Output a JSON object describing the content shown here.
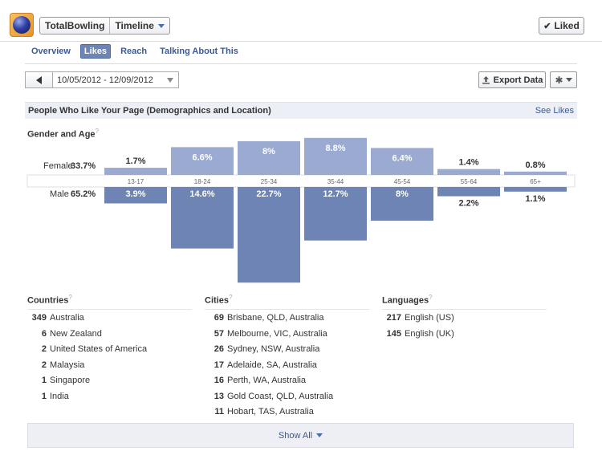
{
  "header": {
    "page_name": "TotalBowling",
    "view_label": "Timeline",
    "liked_label": "Liked"
  },
  "tabs": [
    {
      "label": "Overview",
      "active": false
    },
    {
      "label": "Likes",
      "active": true
    },
    {
      "label": "Reach",
      "active": false
    },
    {
      "label": "Talking About This",
      "active": false
    }
  ],
  "toolbar": {
    "date_range": "10/05/2012 - 12/09/2012",
    "export_label": "Export Data"
  },
  "section": {
    "title": "People Who Like Your Page (Demographics and Location)",
    "link": "See Likes"
  },
  "gender_age": {
    "heading": "Gender and Age",
    "female_label": "Female",
    "female_pct": "33.7%",
    "male_label": "Male",
    "male_pct": "65.2%"
  },
  "chart_data": {
    "type": "bar",
    "title": "Gender and Age",
    "categories": [
      "13-17",
      "18-24",
      "25-34",
      "35-44",
      "45-54",
      "55-64",
      "65+"
    ],
    "series": [
      {
        "name": "Female",
        "values": [
          1.7,
          6.6,
          8,
          8.8,
          6.4,
          1.4,
          0.8
        ],
        "labels": [
          "1.7%",
          "6.6%",
          "8%",
          "8.8%",
          "6.4%",
          "1.4%",
          "0.8%"
        ],
        "color": "#9aaad1"
      },
      {
        "name": "Male",
        "values": [
          3.9,
          14.6,
          22.7,
          12.7,
          8,
          2.2,
          1.1
        ],
        "labels": [
          "3.9%",
          "14.6%",
          "22.7%",
          "12.7%",
          "8%",
          "2.2%",
          "1.1%"
        ],
        "color": "#6d84b4"
      }
    ]
  },
  "countries": {
    "heading": "Countries",
    "items": [
      {
        "count": "349",
        "name": "Australia"
      },
      {
        "count": "6",
        "name": "New Zealand"
      },
      {
        "count": "2",
        "name": "United States of America"
      },
      {
        "count": "2",
        "name": "Malaysia"
      },
      {
        "count": "1",
        "name": "Singapore"
      },
      {
        "count": "1",
        "name": "India"
      }
    ]
  },
  "cities": {
    "heading": "Cities",
    "items": [
      {
        "count": "69",
        "name": "Brisbane, QLD, Australia"
      },
      {
        "count": "57",
        "name": "Melbourne, VIC, Australia"
      },
      {
        "count": "26",
        "name": "Sydney, NSW, Australia"
      },
      {
        "count": "17",
        "name": "Adelaide, SA, Australia"
      },
      {
        "count": "16",
        "name": "Perth, WA, Australia"
      },
      {
        "count": "13",
        "name": "Gold Coast, QLD, Australia"
      },
      {
        "count": "11",
        "name": "Hobart, TAS, Australia"
      }
    ]
  },
  "languages": {
    "heading": "Languages",
    "items": [
      {
        "count": "217",
        "name": "English (US)"
      },
      {
        "count": "145",
        "name": "English (UK)"
      }
    ]
  },
  "footer": {
    "show_all": "Show All"
  },
  "icons": {
    "logo": "bowling-ball-logo",
    "view_dropdown": "caret-down-icon",
    "liked": "check-icon",
    "prev_period": "arrow-left-icon",
    "date_dropdown": "caret-down-icon",
    "export": "upload-icon",
    "settings": "gear-icon",
    "help": "question-icon",
    "show_all": "caret-down-icon"
  }
}
